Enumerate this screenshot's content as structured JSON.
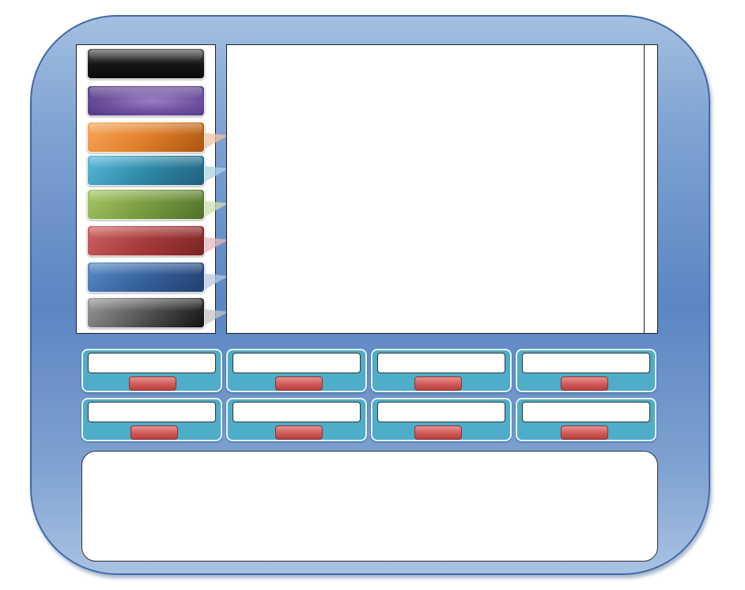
{
  "window": {
    "frame_gradient_top": "#a3bfe0",
    "frame_gradient_mid": "#5b86c4",
    "frame_border": "#3f69a8"
  },
  "sidebar": {
    "items": [
      {
        "name": "black",
        "color_from": "#5a5a5a",
        "color_to": "#0a0a0a"
      },
      {
        "name": "purple",
        "color_from": "#8a6bb4",
        "color_to": "#5a3f8a"
      },
      {
        "name": "orange",
        "color_from": "#f39a48",
        "color_to": "#a85512"
      },
      {
        "name": "teal",
        "color_from": "#4fb1cf",
        "color_to": "#1f5f7a"
      },
      {
        "name": "green",
        "color_from": "#9bbf5c",
        "color_to": "#4f7028"
      },
      {
        "name": "red",
        "color_from": "#c95858",
        "color_to": "#7a2323"
      },
      {
        "name": "blue",
        "color_from": "#4f7fbf",
        "color_to": "#1f3f6f"
      },
      {
        "name": "gray",
        "color_from": "#8a8a8a",
        "color_to": "#222222"
      }
    ]
  },
  "tiles": {
    "accent": "#4eadc9",
    "button_color": "#cf5a58",
    "count": 8
  }
}
